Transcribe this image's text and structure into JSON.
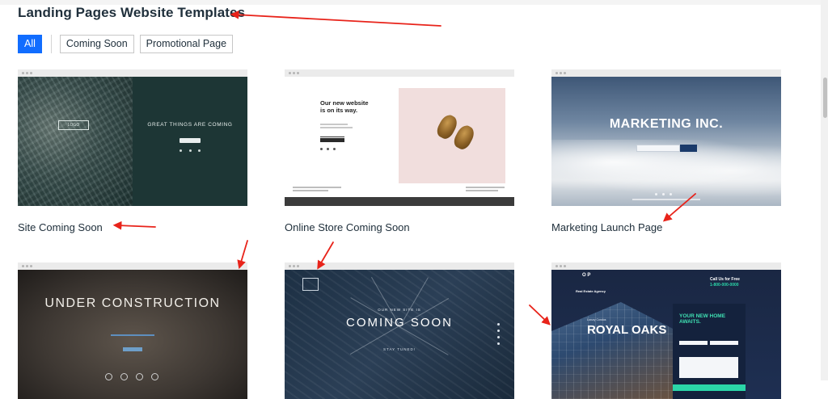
{
  "page_title": "Landing Pages Website Templates",
  "filters": {
    "all_label": "All",
    "coming_soon_label": "Coming Soon",
    "promotional_label": "Promotional Page",
    "active": "All"
  },
  "cards": [
    {
      "title": "Site Coming Soon",
      "preview": {
        "great": "GREAT THINGS ARE COMING"
      }
    },
    {
      "title": "Online Store Coming Soon",
      "preview": {
        "headline": "Our new website is on its way."
      }
    },
    {
      "title": "Marketing Launch Page",
      "preview": {
        "big": "MARKETING INC."
      }
    },
    {
      "title": "",
      "preview": {
        "under": "UNDER CONSTRUCTION"
      }
    },
    {
      "title": "",
      "preview": {
        "pre": "OUR NEW SITE IS",
        "coming": "COMING SOON",
        "stay": "STAY TUNED!"
      }
    },
    {
      "title": "",
      "preview": {
        "op": "O P",
        "agency": "Real Estate Agency",
        "call": "Call Us for Free",
        "phone": "1-800-000-0000",
        "luxury": "Luxury Condos",
        "royal": "ROYAL OAKS",
        "form_heading": "YOUR NEW HOME AWAITS."
      }
    }
  ],
  "colors": {
    "accent": "#116dff",
    "text": "#20303c",
    "annotation_arrow": "#e8231a"
  }
}
